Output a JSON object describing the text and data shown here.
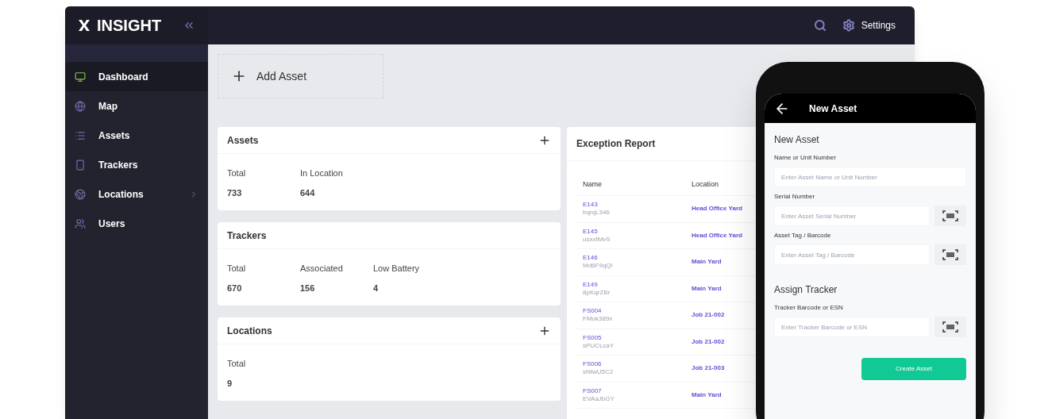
{
  "app": {
    "logo": "INSIGHT",
    "settings": "Settings"
  },
  "sidebar": {
    "items": [
      {
        "label": "Dashboard",
        "selected": true,
        "expandable": false
      },
      {
        "label": "Map",
        "selected": false,
        "expandable": false
      },
      {
        "label": "Assets",
        "selected": false,
        "expandable": false
      },
      {
        "label": "Trackers",
        "selected": false,
        "expandable": false
      },
      {
        "label": "Locations",
        "selected": false,
        "expandable": true
      },
      {
        "label": "Users",
        "selected": false,
        "expandable": false
      }
    ]
  },
  "add_asset": "Add Asset",
  "cards": [
    {
      "title": "Assets",
      "addable": true,
      "stats": [
        {
          "label": "Total",
          "value": "733"
        },
        {
          "label": "In Location",
          "value": "644"
        }
      ]
    },
    {
      "title": "Trackers",
      "addable": false,
      "stats": [
        {
          "label": "Total",
          "value": "670"
        },
        {
          "label": "Associated",
          "value": "156"
        },
        {
          "label": "Low Battery",
          "value": "4"
        }
      ]
    },
    {
      "title": "Locations",
      "addable": true,
      "stats": [
        {
          "label": "Total",
          "value": "9"
        }
      ]
    }
  ],
  "exception_report": {
    "title": "Exception Report",
    "columns": [
      "Name",
      "Location"
    ],
    "rows": [
      {
        "name": "E143",
        "serial": "bqrqL346",
        "location": "Head Office Yard"
      },
      {
        "name": "E145",
        "serial": "usxxtMvS",
        "location": "Head Office Yard"
      },
      {
        "name": "E146",
        "serial": "Md6F9qQi",
        "location": "Main Yard"
      },
      {
        "name": "E149",
        "serial": "8pKqrZBr",
        "location": "Main Yard"
      },
      {
        "name": "FS004",
        "serial": "FMok389x",
        "location": "Job 21-002"
      },
      {
        "name": "FS005",
        "serial": "sPUCLcaY",
        "location": "Job 21-002"
      },
      {
        "name": "FS006",
        "serial": "sNtwU5C2",
        "location": "Job 21-003"
      },
      {
        "name": "FS007",
        "serial": "EVAaJbGY",
        "location": "Main Yard"
      }
    ]
  },
  "phone": {
    "title": "New Asset",
    "form_title": "New Asset",
    "sections": [
      {
        "fields": [
          {
            "label": "Name or Unit Number",
            "placeholder": "Enter Asset Name or Unit Number",
            "scan": false
          },
          {
            "label": "Serial Number",
            "placeholder": "Enter Asset Serial Number",
            "scan": true
          },
          {
            "label": "Asset Tag / Barcode",
            "placeholder": "Enter Asset Tag / Barcode",
            "scan": true
          }
        ]
      },
      {
        "heading": "Assign Tracker",
        "fields": [
          {
            "label": "Tracker Barcode or ESN",
            "placeholder": "Enter Tracker Barcode or ESN",
            "scan": true
          }
        ]
      }
    ],
    "submit": "Create Asset"
  }
}
